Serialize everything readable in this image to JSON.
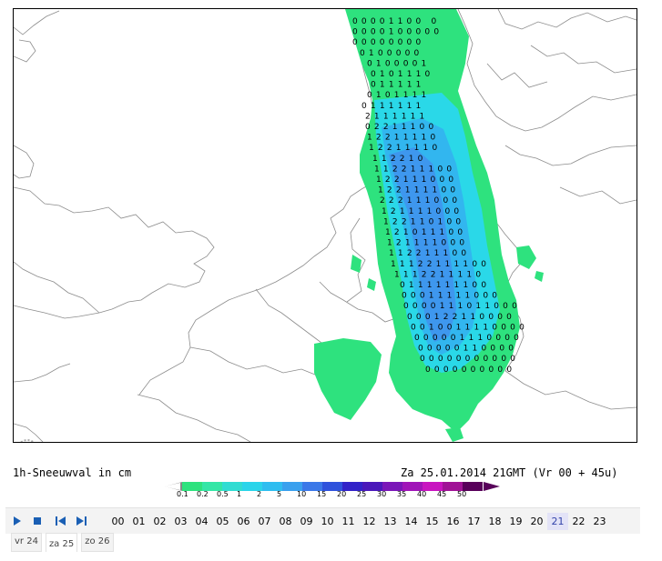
{
  "map": {
    "caption_left": "1h-Sneeuwval in cm",
    "caption_right": "Za 25.01.2014 21GMT (Vr 00 + 45u)",
    "snow_rows": [
      "00001100 0",
      "0000100000",
      "00000000",
      "0100000",
      "0100001",
      "0101110",
      "011111",
      "0101111",
      "0111111",
      "2111111",
      "02211100",
      "12211110",
      "12211110",
      "112210",
      "112211100",
      "122111000",
      "122111100",
      "222111000",
      "121111000",
      "122110100",
      "121011100",
      "121111000",
      "112211100",
      "11122111100",
      "1112211110",
      "0111111100",
      "00011111000",
      "0000111011000",
      "000122110000",
      "0010011110000",
      "000001110000",
      "00000110000",
      "00000000000",
      "0000000000"
    ],
    "colors": {
      "level_01": "#2ee27e",
      "level_02": "#37e8b0",
      "level_05": "#2ad8e8",
      "level_1": "#32b6ef",
      "level_2": "#3e97ee",
      "coast": "#8c8c8c"
    }
  },
  "legend": {
    "labels": [
      "0.1",
      "0.2",
      "0.5",
      "1",
      "2",
      "5",
      "10",
      "15",
      "20",
      "25",
      "30",
      "35",
      "40",
      "45",
      "50"
    ],
    "colors": [
      "#2ee27e",
      "#34e6a6",
      "#31dcd2",
      "#2ad4ea",
      "#2fbdf0",
      "#3aa0ee",
      "#3b78e8",
      "#2f52dc",
      "#3222c8",
      "#4a18ba",
      "#7a16b8",
      "#a014b8",
      "#c814c0",
      "#a01296",
      "#58005a"
    ]
  },
  "controls": {
    "play_icon": "play-icon",
    "stop_icon": "stop-icon",
    "prev_icon": "skip-back-icon",
    "next_icon": "skip-forward-icon",
    "hours": [
      "00",
      "01",
      "02",
      "03",
      "04",
      "05",
      "06",
      "07",
      "08",
      "09",
      "10",
      "11",
      "12",
      "13",
      "14",
      "15",
      "16",
      "17",
      "18",
      "19",
      "20",
      "21",
      "22",
      "23"
    ],
    "active_hour": "21",
    "days": [
      "vr 24",
      "za 25",
      "zo 26"
    ],
    "active_day": "za 25"
  }
}
